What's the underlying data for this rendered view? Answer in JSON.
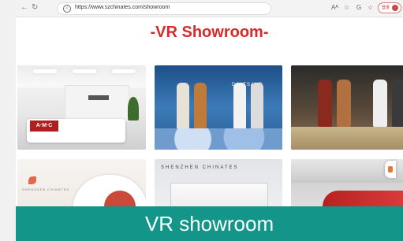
{
  "browser": {
    "url": "https://www.szchinates.com/showroom",
    "profile_label": "登录"
  },
  "page": {
    "title": "-VR Showroom-"
  },
  "tiles": [
    {
      "logo_text": "A·M·C"
    },
    {
      "sign_text": "DALTSAND"
    },
    {
      "sign_text": ""
    },
    {
      "logo_text": "SHENZHEN CHINATES"
    },
    {
      "banner_text": "SHENZHEN CHINATES"
    },
    {}
  ],
  "caption": {
    "text": "VR showroom"
  },
  "colors": {
    "title_red": "#d82a2a",
    "caption_teal": "#13958a"
  }
}
